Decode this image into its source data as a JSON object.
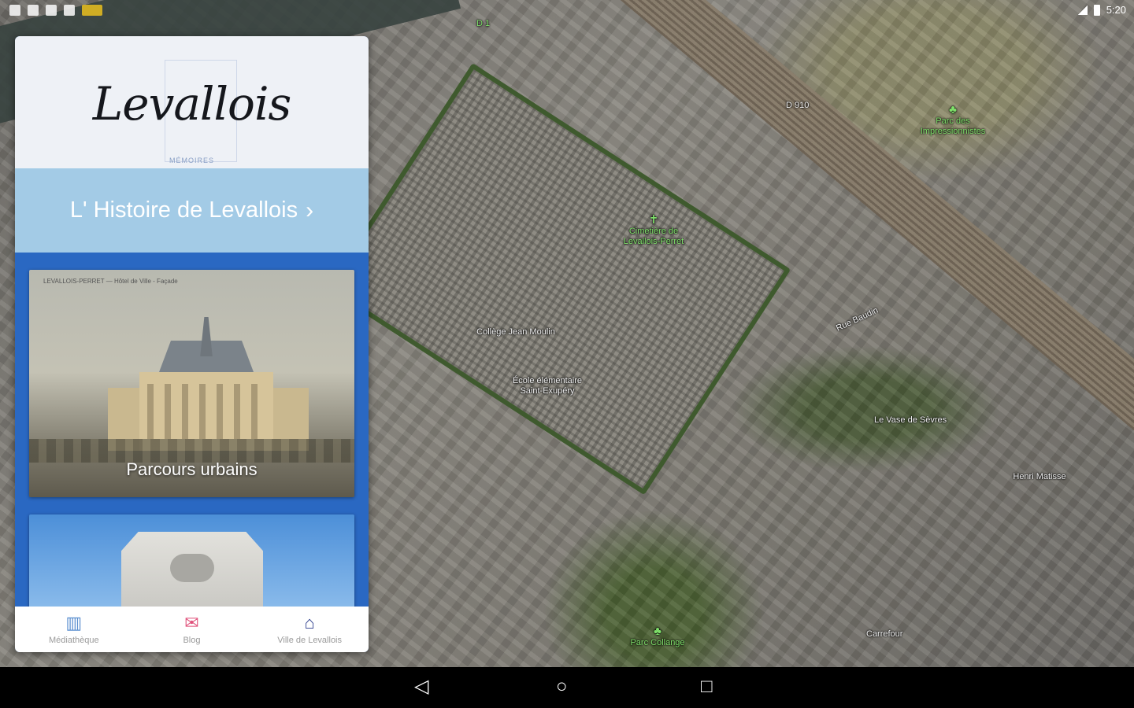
{
  "status_bar": {
    "time": "5:20"
  },
  "app": {
    "logo_text": "Levallois",
    "logo_subtitle": "MÉMOIRES",
    "history_banner": {
      "label": "L' Histoire de Levallois",
      "chevron": "›"
    },
    "cards": [
      {
        "title": "Parcours urbains",
        "caption": "LEVALLOIS-PERRET — Hôtel de Ville - Façade"
      },
      {
        "title": ""
      }
    ],
    "bottom_nav": [
      {
        "label": "Médiathèque",
        "icon": "book-icon"
      },
      {
        "label": "Blog",
        "icon": "chat-icon"
      },
      {
        "label": "Ville de Levallois",
        "icon": "city-hall-icon"
      }
    ]
  },
  "map": {
    "labels": {
      "cemetery": "Cimetière de Levallois-Perret",
      "park_top": "Parc des Impressionnistes",
      "college": "Collège Jean Moulin",
      "school": "École élémentaire Saint-Exupéry",
      "street_rue": "Rue Baudin",
      "clinic": "Le Vase de Sèvres",
      "park_bottom": "Parc Collange",
      "henri": "Henri Matisse",
      "pin_road": "D 910",
      "pin_road2": "D 1",
      "carrefour": "Carrefour"
    },
    "colors": {
      "poi_green": "#7fe06a",
      "panel_blue": "#2a68c2",
      "banner_blue": "#a3cbe6"
    }
  },
  "nav_bar": {
    "back": "◁",
    "home": "○",
    "recent": "□"
  }
}
